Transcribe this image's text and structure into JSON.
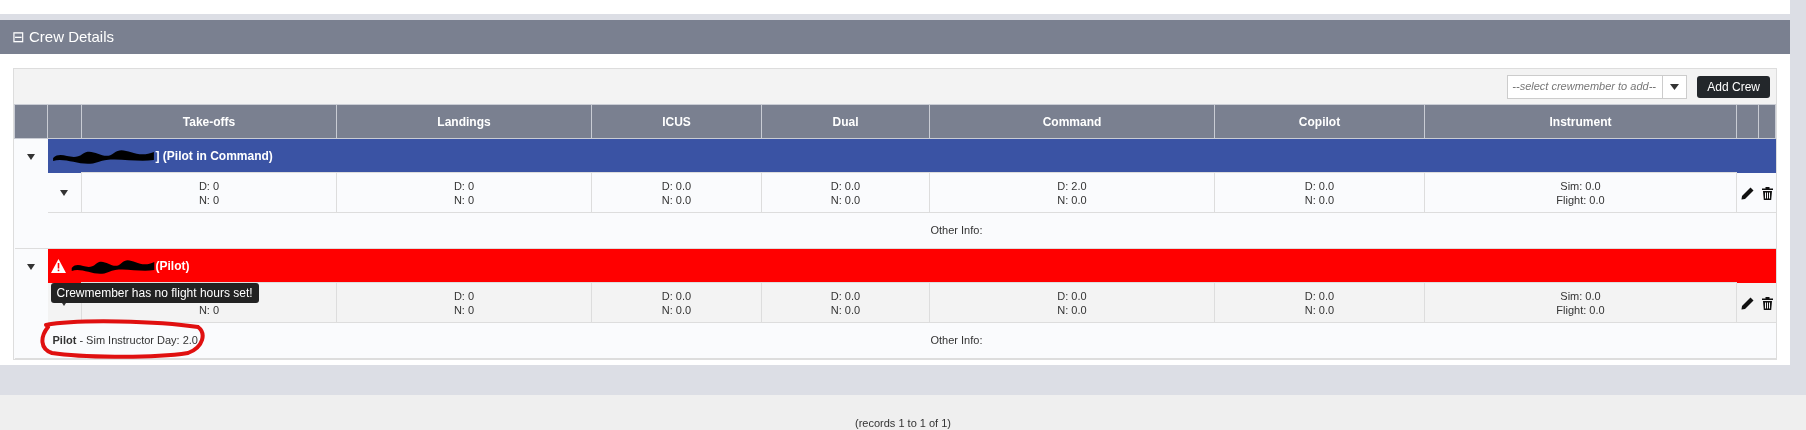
{
  "panel": {
    "title": "Crew Details",
    "collapse_icon": "⊟"
  },
  "toolbar": {
    "select_placeholder": "--select crewmember to add--",
    "button": "Add Crew"
  },
  "table": {
    "columns": [
      "Take-offs",
      "Landings",
      "ICUS",
      "Dual",
      "Command",
      "Copilot",
      "Instrument"
    ],
    "groups": [
      {
        "role": "] (Pilot in Command)",
        "kind": "ok",
        "warning": false,
        "cells": [
          [
            "D: 0",
            "N: 0"
          ],
          [
            "D: 0",
            "N: 0"
          ],
          [
            "D: 0.0",
            "N: 0.0"
          ],
          [
            "D: 0.0",
            "N: 0.0"
          ],
          [
            "D: 2.0",
            "N: 0.0"
          ],
          [
            "D: 0.0",
            "N: 0.0"
          ],
          [
            "Sim: 0.0",
            "Flight: 0.0"
          ]
        ],
        "other_info": "Other Info:"
      },
      {
        "role": " (Pilot)",
        "kind": "error",
        "warning": true,
        "tooltip": "Crewmember has no flight hours set!",
        "cells": [
          [
            null,
            "N: 0"
          ],
          [
            "D: 0",
            "N: 0"
          ],
          [
            "D: 0.0",
            "N: 0.0"
          ],
          [
            "D: 0.0",
            "N: 0.0"
          ],
          [
            "D: 0.0",
            "N: 0.0"
          ],
          [
            "D: 0.0",
            "N: 0.0"
          ],
          [
            "Sim: 0.0",
            "Flight: 0.0"
          ]
        ],
        "info": "**Pilot** - Sim Instructor Day: 2.0",
        "other_info": "Other Info:"
      }
    ]
  },
  "footer": "(records 1 to 1 of 1)"
}
